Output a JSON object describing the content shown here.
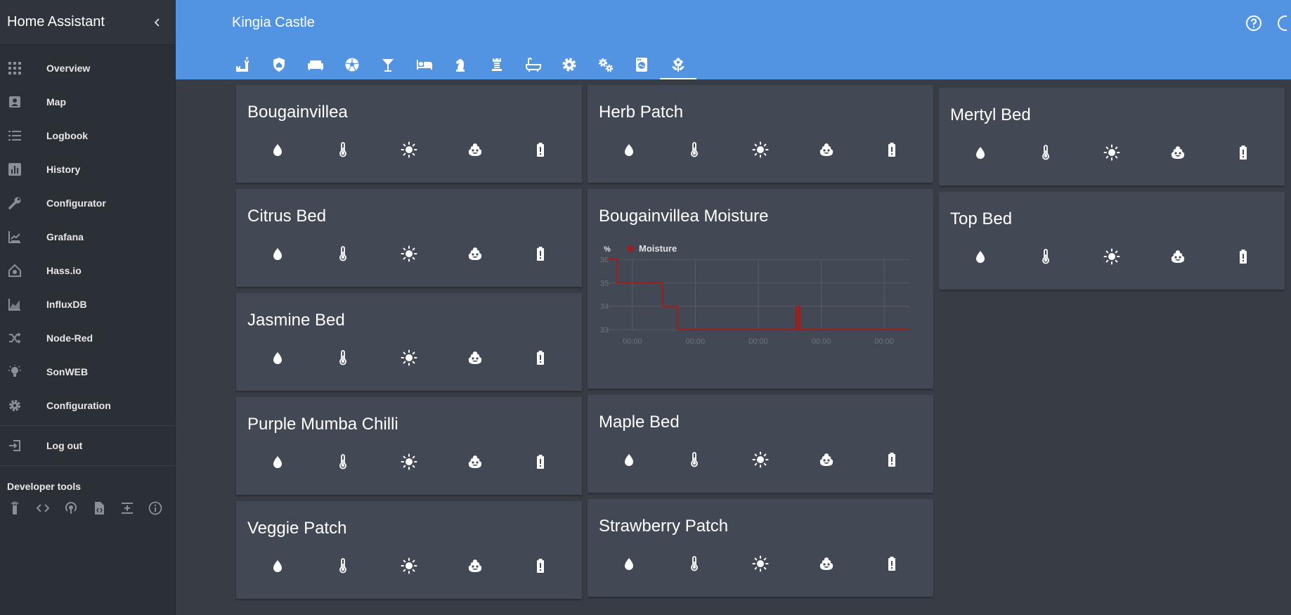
{
  "sidebar": {
    "title": "Home Assistant",
    "items": [
      {
        "label": "Overview",
        "icon": "grid-icon"
      },
      {
        "label": "Map",
        "icon": "map-icon"
      },
      {
        "label": "Logbook",
        "icon": "logbook-icon"
      },
      {
        "label": "History",
        "icon": "history-chart-icon"
      },
      {
        "label": "Configurator",
        "icon": "wrench-icon"
      },
      {
        "label": "Grafana",
        "icon": "chart-line-icon"
      },
      {
        "label": "Hass.io",
        "icon": "home-assistant-icon"
      },
      {
        "label": "InfluxDB",
        "icon": "chart-area-icon"
      },
      {
        "label": "Node-Red",
        "icon": "shuffle-icon"
      },
      {
        "label": "SonWEB",
        "icon": "lightbulb-icon"
      },
      {
        "label": "Configuration",
        "icon": "gear-icon"
      }
    ],
    "logout": "Log out",
    "dev_tools_label": "Developer tools",
    "dev_tools": [
      "remote-icon",
      "code-icon",
      "antenna-icon",
      "file-code-icon",
      "arrow-expand-icon",
      "info-icon"
    ]
  },
  "header": {
    "title": "Kingia Castle",
    "tabs": [
      "castle-icon",
      "shield-home-icon",
      "sofa-icon",
      "soccer-icon",
      "glass-cocktail-icon",
      "bed-icon",
      "chess-knight-icon",
      "chess-rook-icon",
      "bathtub-icon",
      "gear-icon",
      "gears-icon",
      "washing-machine-icon",
      "flower-icon"
    ],
    "active_tab": 12
  },
  "plant_icons": [
    "water-icon",
    "thermometer-icon",
    "sun-icon",
    "poop-icon",
    "battery-alert-icon"
  ],
  "cards": {
    "bougainvillea": "Bougainvillea",
    "citrus_bed": "Citrus Bed",
    "jasmine_bed": "Jasmine Bed",
    "purple_mumba_chilli": "Purple Mumba Chilli",
    "veggie_patch": "Veggie Patch",
    "herb_patch": "Herb Patch",
    "bougainvillea_moisture": "Bougainvillea Moisture",
    "maple_bed": "Maple Bed",
    "strawberry_patch": "Strawberry Patch",
    "mertyl_bed": "Mertyl Bed",
    "top_bed": "Top Bed"
  },
  "chart_data": {
    "type": "line",
    "title": "Bougainvillea Moisture",
    "ylabel": "%",
    "ylim": [
      33,
      36
    ],
    "yticks": [
      33,
      34,
      35,
      36
    ],
    "xticks": [
      "00:00",
      "00:00",
      "00:00",
      "00:00",
      "00:00"
    ],
    "grid": true,
    "legend_position": "top-left",
    "series": [
      {
        "name": "Moisture",
        "color": "#a21c1c",
        "x": [
          0,
          0.0,
          0.8,
          0.8,
          4.4,
          4.4,
          5.6,
          5.6,
          5.8,
          5.8,
          6.2,
          6.2,
          15.0,
          15.0,
          15.05,
          15.05,
          15.25,
          15.25,
          15.3,
          15.3,
          24.0
        ],
        "y": [
          36,
          36,
          36,
          35,
          35,
          34,
          34,
          33,
          33,
          33,
          33,
          33,
          33,
          34,
          34,
          33,
          33,
          34,
          34,
          33,
          33
        ]
      }
    ],
    "xlim": [
      0,
      24
    ],
    "xtick_positions": [
      2,
      7,
      12,
      17,
      22
    ]
  },
  "colors": {
    "header": "#5294e2",
    "sidebar": "#2b2f36",
    "background": "#383c45",
    "card": "#434954",
    "moisture_line": "#a21c1c"
  }
}
